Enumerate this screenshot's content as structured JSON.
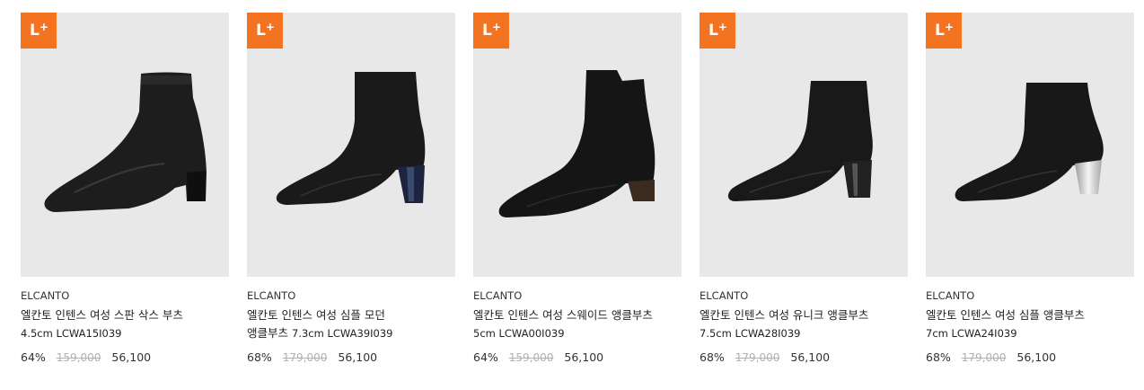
{
  "badge": {
    "text": "L",
    "plus": "+"
  },
  "colors": {
    "badge_bg": "#f37321",
    "thumb_bg": "#e8e8e8"
  },
  "products": [
    {
      "brand": "ELCANTO",
      "name": "엘칸토 인텐스 여성 스판 삭스 부츠",
      "model": "4.5cm LCWA15I039",
      "discount": "64%",
      "original_price": "159,000",
      "sale_price": "56,100",
      "image_icon": "black-stretch-sock-boot-image"
    },
    {
      "brand": "ELCANTO",
      "name": "엘칸토 인텐스 여성 심플 모던 앵클부츠",
      "model": "7.3cm LCWA39I039",
      "discount": "68%",
      "original_price": "179,000",
      "sale_price": "56,100",
      "image_icon": "black-leather-ankle-boot-image"
    },
    {
      "brand": "ELCANTO",
      "name": "엘칸토 인텐스 여성 스웨이드 앵클부츠",
      "model": "5cm LCWA00I039",
      "discount": "64%",
      "original_price": "159,000",
      "sale_price": "56,100",
      "image_icon": "black-suede-ankle-boot-image"
    },
    {
      "brand": "ELCANTO",
      "name": "엘칸토 인텐스 여성 유니크 앵클부츠",
      "model": "7.5cm LCWA28I039",
      "discount": "68%",
      "original_price": "179,000",
      "sale_price": "56,100",
      "image_icon": "black-pointed-ankle-boot-image"
    },
    {
      "brand": "ELCANTO",
      "name": "엘칸토 인텐스 여성 심플 앵클부츠",
      "model": "7cm LCWA24I039",
      "discount": "68%",
      "original_price": "179,000",
      "sale_price": "56,100",
      "image_icon": "black-silver-heel-ankle-boot-image"
    }
  ]
}
